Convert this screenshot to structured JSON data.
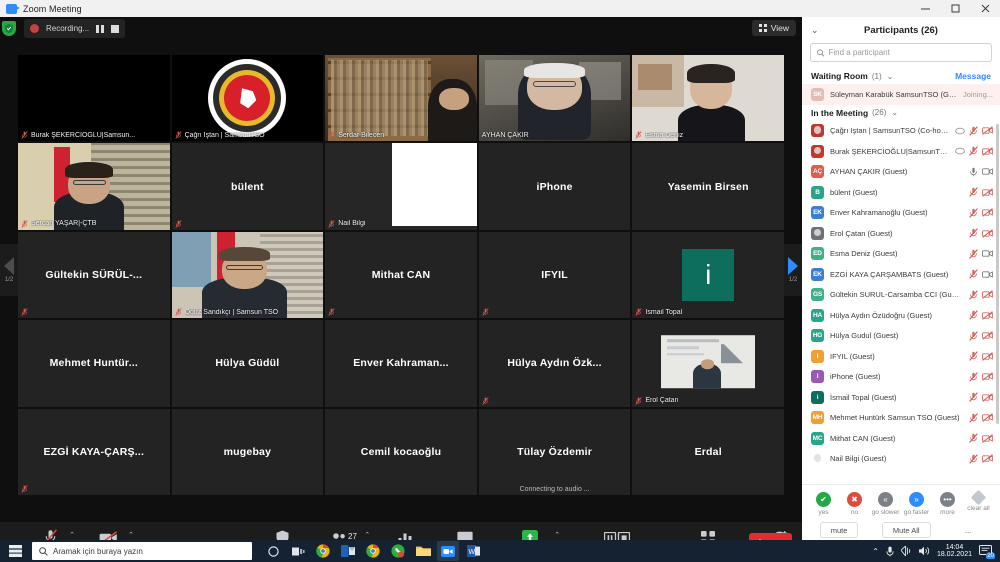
{
  "window": {
    "title": "Zoom Meeting",
    "minimize_label": "Minimize",
    "maximize_label": "Maximize",
    "close_label": "Close"
  },
  "recording": {
    "status_text": "Recording...",
    "pause_label": "Pause Recording",
    "stop_label": "Stop Recording",
    "encryption_label": "Encryption"
  },
  "view": {
    "label": "View"
  },
  "pager": {
    "left_label": "Previous page",
    "right_label": "Next page",
    "count": "1/2"
  },
  "tiles": [
    {
      "name": "Burak ŞEKERCİOĞLU|Samsun...",
      "display": "corner",
      "muted": true,
      "video": "black",
      "active": false
    },
    {
      "name": "Çağrı Iştan | SamsunTSO",
      "display": "corner",
      "muted": true,
      "video": "logo",
      "active": false
    },
    {
      "name": "Serdar Bilecen",
      "display": "corner",
      "muted": true,
      "video": "books",
      "active": false
    },
    {
      "name": "AYHAN ÇAKIR",
      "display": "corner",
      "muted": false,
      "video": "speaker",
      "active": true
    },
    {
      "name": "Esma Deniz",
      "display": "corner",
      "muted": true,
      "video": "woman",
      "active": false
    },
    {
      "name": "Sercan YAŞAR|-ÇTB",
      "display": "corner",
      "muted": true,
      "video": "man-flag",
      "active": false
    },
    {
      "name": "bülent",
      "display": "center",
      "muted": true,
      "video": "none",
      "active": false
    },
    {
      "name": "Nail Bilgi",
      "display": "corner",
      "muted": true,
      "video": "white",
      "active": false
    },
    {
      "name": "iPhone",
      "display": "center",
      "muted": false,
      "video": "none",
      "active": false
    },
    {
      "name": "Yasemin Birsen",
      "display": "center",
      "muted": false,
      "video": "none",
      "active": false
    },
    {
      "name": "Gültekin  SÜRÜL-...",
      "display": "center",
      "muted": true,
      "video": "none",
      "active": false
    },
    {
      "name": "Oğuz Sandıkçı | Samsun TSO",
      "display": "corner",
      "muted": true,
      "video": "man-office",
      "active": false
    },
    {
      "name": "Mithat CAN",
      "display": "center",
      "muted": true,
      "video": "none",
      "active": false
    },
    {
      "name": "IFYIL",
      "display": "center",
      "muted": true,
      "video": "none",
      "active": false
    },
    {
      "name": "İsmail Topal",
      "display": "corner",
      "muted": true,
      "video": "avatar-i",
      "avatar_letter": "i",
      "avatar_color": "#0d6e5e",
      "active": false
    },
    {
      "name": "Mehmet  Huntür...",
      "display": "center",
      "muted": false,
      "video": "none",
      "active": false
    },
    {
      "name": "Hülya Güdül",
      "display": "center",
      "muted": false,
      "video": "none",
      "active": false
    },
    {
      "name": "Enver Kahraman...",
      "display": "center",
      "muted": false,
      "video": "none",
      "active": false
    },
    {
      "name": "Hülya Aydın Özk...",
      "display": "center",
      "muted": true,
      "video": "none",
      "active": false
    },
    {
      "name": "Erol Çatan",
      "display": "corner",
      "muted": true,
      "video": "presentation",
      "active": false
    },
    {
      "name": "EZGİ  KAYA-ÇARŞ...",
      "display": "center",
      "muted": true,
      "video": "none",
      "active": false
    },
    {
      "name": "mugebay",
      "display": "center",
      "muted": false,
      "video": "none",
      "active": false
    },
    {
      "name": "Cemil kocaoğlu",
      "display": "center",
      "muted": false,
      "video": "none",
      "active": false
    },
    {
      "name": "Tülay Özdemir",
      "display": "center",
      "muted": false,
      "video": "none",
      "active": false,
      "status": "Connecting to audio ..."
    },
    {
      "name": "Erdal",
      "display": "center",
      "muted": false,
      "video": "none",
      "active": false
    }
  ],
  "toolbar": {
    "unmute": "Unmute",
    "start_video": "Start Video",
    "security": "Security",
    "participants": "Participants",
    "participants_count": "27",
    "polls": "Polls",
    "chat": "Chat",
    "share_screen": "Share Screen",
    "recording": "Pause/Stop Recording",
    "breakout": "Breakout Rooms",
    "reactions": "Reactions",
    "leave": "Leave"
  },
  "panel": {
    "title": "Participants (26)",
    "search_placeholder": "Find a participant",
    "search_value": "",
    "waiting_room": {
      "label": "Waiting Room",
      "count": "(1)"
    },
    "message_link": "Message",
    "in_meeting": {
      "label": "In the Meeting",
      "count": "(26)"
    },
    "waiting_participants": [
      {
        "name": "Süleyman Karabük SamsunTSO (Guest)",
        "initials": "SK",
        "color": "#e5bcb3",
        "status": "Joining..."
      }
    ],
    "participants": [
      {
        "name": "Çağrı Iştan | SamsunTSO (Co-host, me)",
        "initials": "",
        "color": "#c0392b",
        "photo": true,
        "muted": true,
        "video_off": true,
        "host_icon": true
      },
      {
        "name": "Burak ŞEKERCİOĞLU|SamsunTSO (Host)",
        "initials": "",
        "color": "#c0392b",
        "photo": true,
        "muted": true,
        "video_off": true,
        "host_icon": true
      },
      {
        "name": "AYHAN ÇAKIR (Guest)",
        "initials": "AÇ",
        "color": "#e05c4b",
        "muted": false,
        "video_off": false
      },
      {
        "name": "bülent (Guest)",
        "initials": "B",
        "color": "#2aa58b",
        "muted": true,
        "video_off": true
      },
      {
        "name": "Enver Kahramanoğlu (Guest)",
        "initials": "EK",
        "color": "#3b7fd4",
        "muted": true,
        "video_off": true
      },
      {
        "name": "Erol Çatan (Guest)",
        "initials": "",
        "color": "#6d7278",
        "photo": true,
        "muted": true,
        "video_off": true
      },
      {
        "name": "Esma Deniz (Guest)",
        "initials": "ED",
        "color": "#3fb08a",
        "muted": true,
        "video_off": false
      },
      {
        "name": "EZGİ KAYA ÇARŞAMBATS (Guest)",
        "initials": "EK",
        "color": "#3b7fd4",
        "muted": true,
        "video_off": false
      },
      {
        "name": "Gültekin SURUL-Carsamba CCI (Guest)",
        "initials": "GS",
        "color": "#3fb08a",
        "muted": true,
        "video_off": true
      },
      {
        "name": "Hülya Aydın Özüdoğru (Guest)",
        "initials": "HA",
        "color": "#2aa58b",
        "muted": true,
        "video_off": true
      },
      {
        "name": "Hülya Gudul (Guest)",
        "initials": "HG",
        "color": "#2aa58b",
        "muted": true,
        "video_off": true
      },
      {
        "name": "IFYIL (Guest)",
        "initials": "I",
        "color": "#f0a030",
        "muted": true,
        "video_off": true
      },
      {
        "name": "iPhone (Guest)",
        "initials": "I",
        "color": "#9b59b6",
        "muted": true,
        "video_off": true
      },
      {
        "name": "İsmail Topal (Guest)",
        "initials": "i",
        "color": "#0d6e5e",
        "muted": true,
        "video_off": true
      },
      {
        "name": "Mehmet Huntürk Samsun TSO (Guest)",
        "initials": "MH",
        "color": "#f0a030",
        "muted": true,
        "video_off": true
      },
      {
        "name": "Mithat CAN (Guest)",
        "initials": "MC",
        "color": "#2aa58b",
        "muted": true,
        "video_off": true
      },
      {
        "name": "Nail Bilgi (Guest)",
        "initials": "",
        "color": "#ffffff",
        "photo": true,
        "muted": true,
        "video_off": true
      }
    ],
    "reactions": [
      {
        "label": "yes",
        "glyph": "✔",
        "color": "#27a745"
      },
      {
        "label": "no",
        "glyph": "✖",
        "color": "#e04b3c"
      },
      {
        "label": "go slower",
        "glyph": "«",
        "color": "#7b8187"
      },
      {
        "label": "go faster",
        "glyph": "»",
        "color": "#2d8cff"
      },
      {
        "label": "more",
        "glyph": "•••",
        "color": "#7b8187"
      },
      {
        "label": "clear all",
        "glyph": "",
        "color": "#c3c8cf"
      }
    ],
    "buttons": {
      "mute": "mute",
      "mute_all": "Mute All",
      "more": "..."
    }
  },
  "taskbar": {
    "search_placeholder": "Aramak için buraya yazın",
    "clock_time": "14:04",
    "clock_date": "18.02.2021",
    "notification_count": "20"
  }
}
